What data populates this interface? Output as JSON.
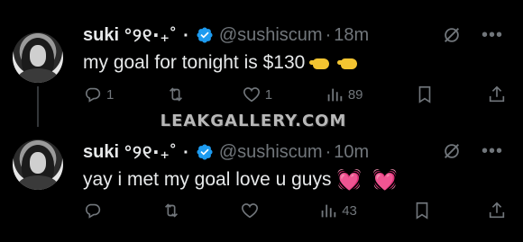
{
  "watermark": "LEAKGALLERY.COM",
  "tweets": [
    {
      "name": "suki",
      "name_suffix": "°୨୧‧₊˚ ·",
      "handle": "@sushiscum",
      "separator": "·",
      "time": "18m",
      "text": "my goal for tonight is $130",
      "text_emoji_names": [
        "backhand-index-pointing-left-icon",
        "backhand-index-pointing-left-icon"
      ],
      "actions": {
        "reply": "1",
        "repost": "",
        "like": "1",
        "views": "89"
      }
    },
    {
      "name": "suki",
      "name_suffix": "°୨୧‧₊˚ ·",
      "handle": "@sushiscum",
      "separator": "·",
      "time": "10m",
      "text": "yay i met my goal love u guys",
      "text_emoji": "💓 💓",
      "actions": {
        "reply": "",
        "repost": "",
        "like": "",
        "views": "43"
      }
    }
  ],
  "colors": {
    "background": "#000000",
    "text": "#e7e9ea",
    "muted": "#71767b",
    "verified": "#1d9bf0",
    "hearts": "#ff4fb6"
  }
}
